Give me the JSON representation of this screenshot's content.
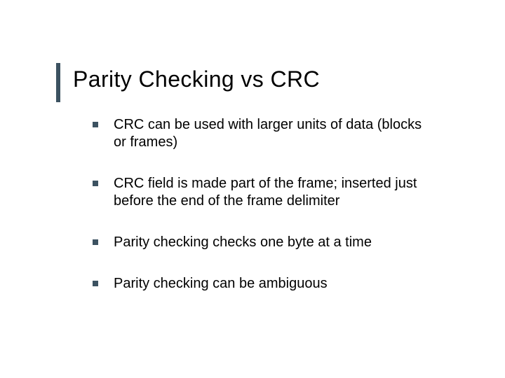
{
  "title": "Parity Checking vs CRC",
  "bullets": [
    "CRC can be used with larger units of data (blocks or frames)",
    "CRC field is made part of the frame; inserted just before the end of the frame delimiter",
    "Parity checking checks one byte at a time",
    "Parity checking can be ambiguous"
  ],
  "colors": {
    "accent": "#3c5261"
  }
}
